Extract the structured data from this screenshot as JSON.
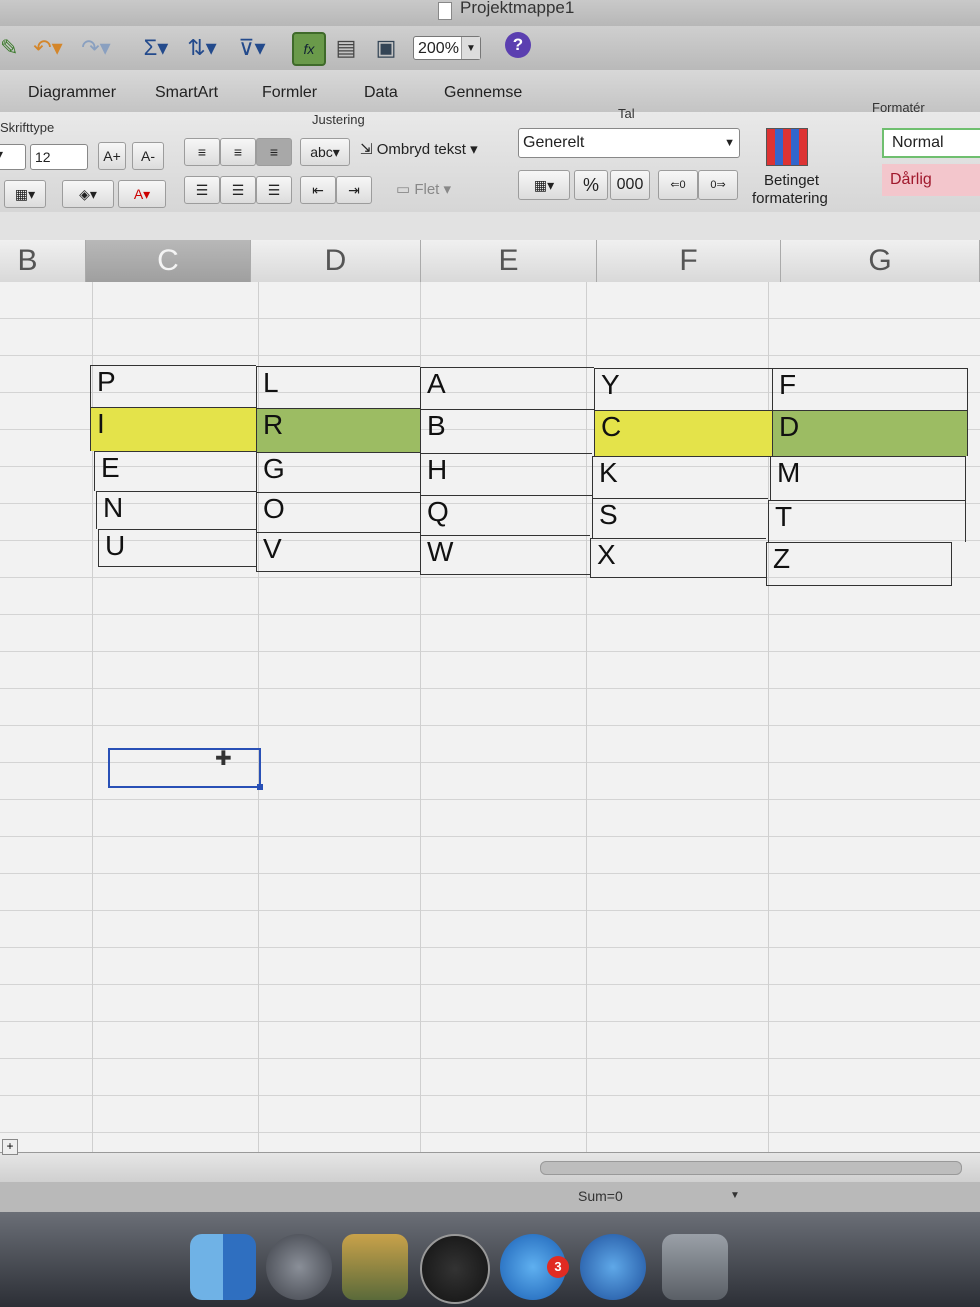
{
  "window": {
    "title": "Projektmappe1"
  },
  "toolbar": {
    "zoom": "200%",
    "help": "?"
  },
  "tabs": [
    "Diagrammer",
    "SmartArt",
    "Formler",
    "Data",
    "Gennemse"
  ],
  "ribbon": {
    "font_group_label": "Skrifttype",
    "font_size": "12",
    "align_group_label": "Justering",
    "abc_label": "abc",
    "wrap_text_label": "Ombryd tekst",
    "merge_label": "Flet",
    "number_group_label": "Tal",
    "number_format": "Generelt",
    "percent": "%",
    "thousands": "000",
    "cond_format_line1": "Betinget",
    "cond_format_line2": "formatering",
    "styles_group_label": "Formatér",
    "style_normal": "Normal",
    "style_bad": "Dårlig"
  },
  "columns": [
    "B",
    "C",
    "D",
    "E",
    "F",
    "G"
  ],
  "grid": {
    "rows": [
      [
        "P",
        "L",
        "A",
        "Y",
        "F"
      ],
      [
        "I",
        "R",
        "B",
        "C",
        "D"
      ],
      [
        "E",
        "G",
        "H",
        "K",
        "M"
      ],
      [
        "N",
        "O",
        "Q",
        "S",
        "T"
      ],
      [
        "U",
        "V",
        "W",
        "X",
        "Z"
      ]
    ],
    "highlight_colors": {
      "yellow": "#e4e34a",
      "green": "#9cbc63"
    }
  },
  "status": {
    "sum": "Sum=0"
  }
}
